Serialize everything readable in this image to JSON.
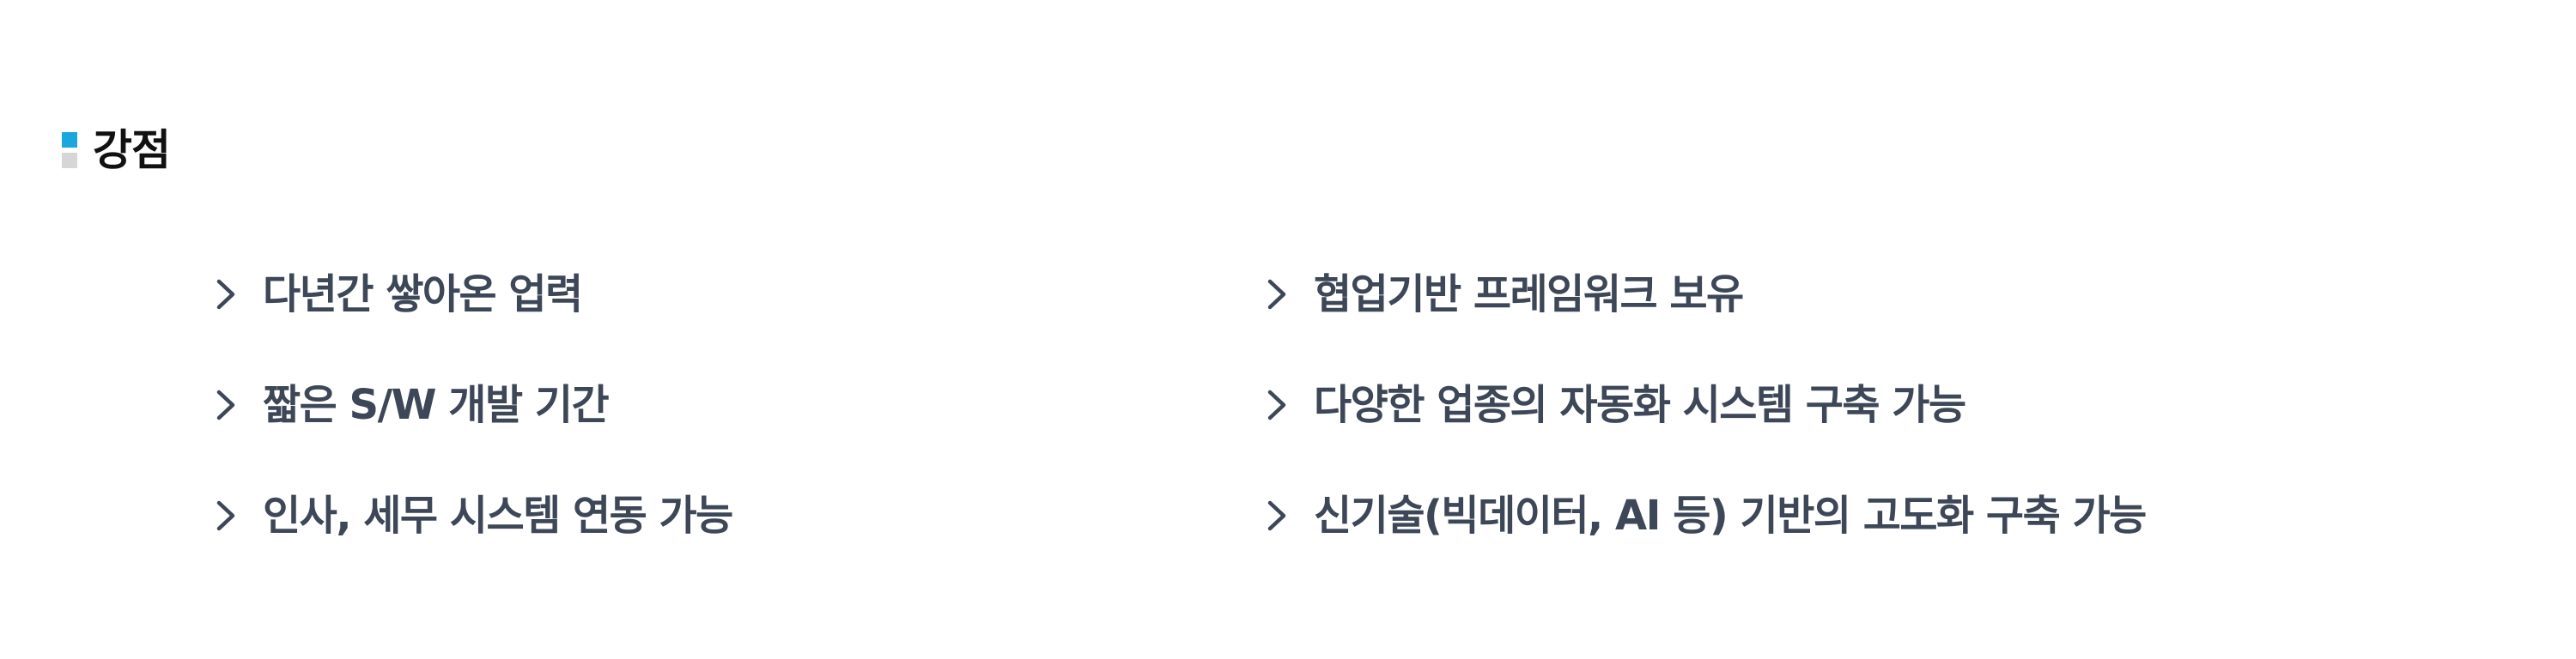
{
  "section": {
    "title": "강점",
    "marker_colors": {
      "top": "#1aa7de",
      "bottom": "#d6d6d6"
    }
  },
  "left_items": [
    {
      "label": "다년간 쌓아온 업력",
      "icon": "chevron-right-icon"
    },
    {
      "label": "짧은 S/W 개발 기간",
      "icon": "chevron-right-icon"
    },
    {
      "label": "인사, 세무 시스템 연동 가능",
      "icon": "chevron-right-icon"
    }
  ],
  "right_items": [
    {
      "label": "협업기반 프레임워크 보유",
      "icon": "chevron-right-icon"
    },
    {
      "label": "다양한 업종의 자동화 시스템 구축 가능",
      "icon": "chevron-right-icon"
    },
    {
      "label": "신기술(빅데이터, AI 등) 기반의 고도화 구축 가능",
      "icon": "chevron-right-icon"
    }
  ],
  "colors": {
    "text": "#3d4757",
    "title": "#111111",
    "chevron": "#3d4757"
  }
}
